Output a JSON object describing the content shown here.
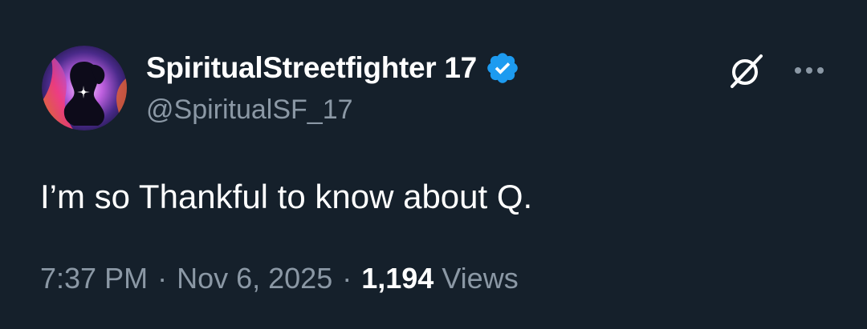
{
  "author": {
    "display_name": "SpiritualStreetfighter 17",
    "handle": "@SpiritualSF_17",
    "verified": true
  },
  "tweet": {
    "text": "I’m so Thankful to know about Q."
  },
  "meta": {
    "time": "7:37 PM",
    "separator": "·",
    "date": "Nov 6, 2025",
    "views_count": "1,194",
    "views_label": "Views"
  },
  "icons": {
    "avatar": "avatar-silhouette-icon",
    "verified": "verified-badge-icon",
    "grok": "grok-icon",
    "more": "more-options-icon"
  },
  "colors": {
    "background": "#15202b",
    "text_primary": "#ffffff",
    "text_secondary": "#8b98a5",
    "verified_blue": "#1d9bf0"
  }
}
